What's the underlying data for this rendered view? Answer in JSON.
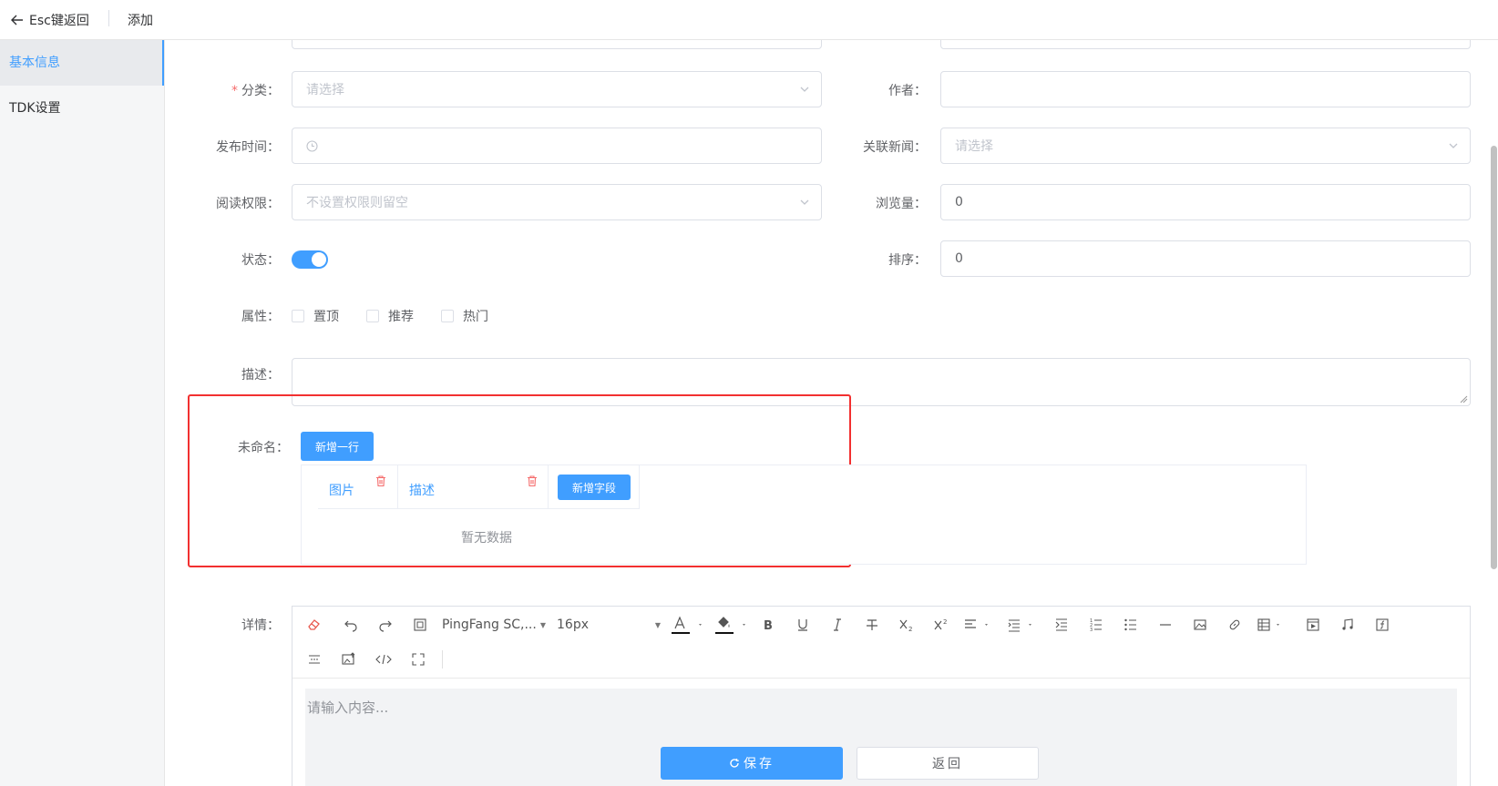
{
  "topbar": {
    "back_label": "Esc键返回",
    "title": "添加"
  },
  "sidebar": {
    "items": [
      {
        "label": "基本信息",
        "active": true
      },
      {
        "label": "TDK设置",
        "active": false
      }
    ]
  },
  "form": {
    "category": {
      "label": "分类：",
      "placeholder": "请选择",
      "required_mark": "*"
    },
    "author": {
      "label": "作者：",
      "value": ""
    },
    "publish_time": {
      "label": "发布时间：",
      "value": ""
    },
    "related_news": {
      "label": "关联新闻：",
      "placeholder": "请选择"
    },
    "read_permission": {
      "label": "阅读权限：",
      "placeholder": "不设置权限则留空"
    },
    "views": {
      "label": "浏览量：",
      "value": "0"
    },
    "status": {
      "label": "状态：",
      "on": true
    },
    "sort": {
      "label": "排序：",
      "value": "0"
    },
    "attributes": {
      "label": "属性：",
      "options": [
        "置顶",
        "推荐",
        "热门"
      ]
    },
    "description": {
      "label": "描述：",
      "value": ""
    },
    "unnamed": {
      "label": "未命名：",
      "add_row_label": "新增一行",
      "columns": [
        "图片",
        "描述"
      ],
      "add_field_label": "新增字段",
      "empty_text": "暂无数据"
    },
    "details": {
      "label": "详情：",
      "font_family": "PingFang SC,...",
      "font_size": "16px",
      "placeholder": "请输入内容..."
    }
  },
  "actions": {
    "save_label": "保存",
    "back_label": "返回"
  },
  "colors": {
    "primary": "#409eff",
    "highlight": "#f23030",
    "danger": "#f56c6c"
  }
}
